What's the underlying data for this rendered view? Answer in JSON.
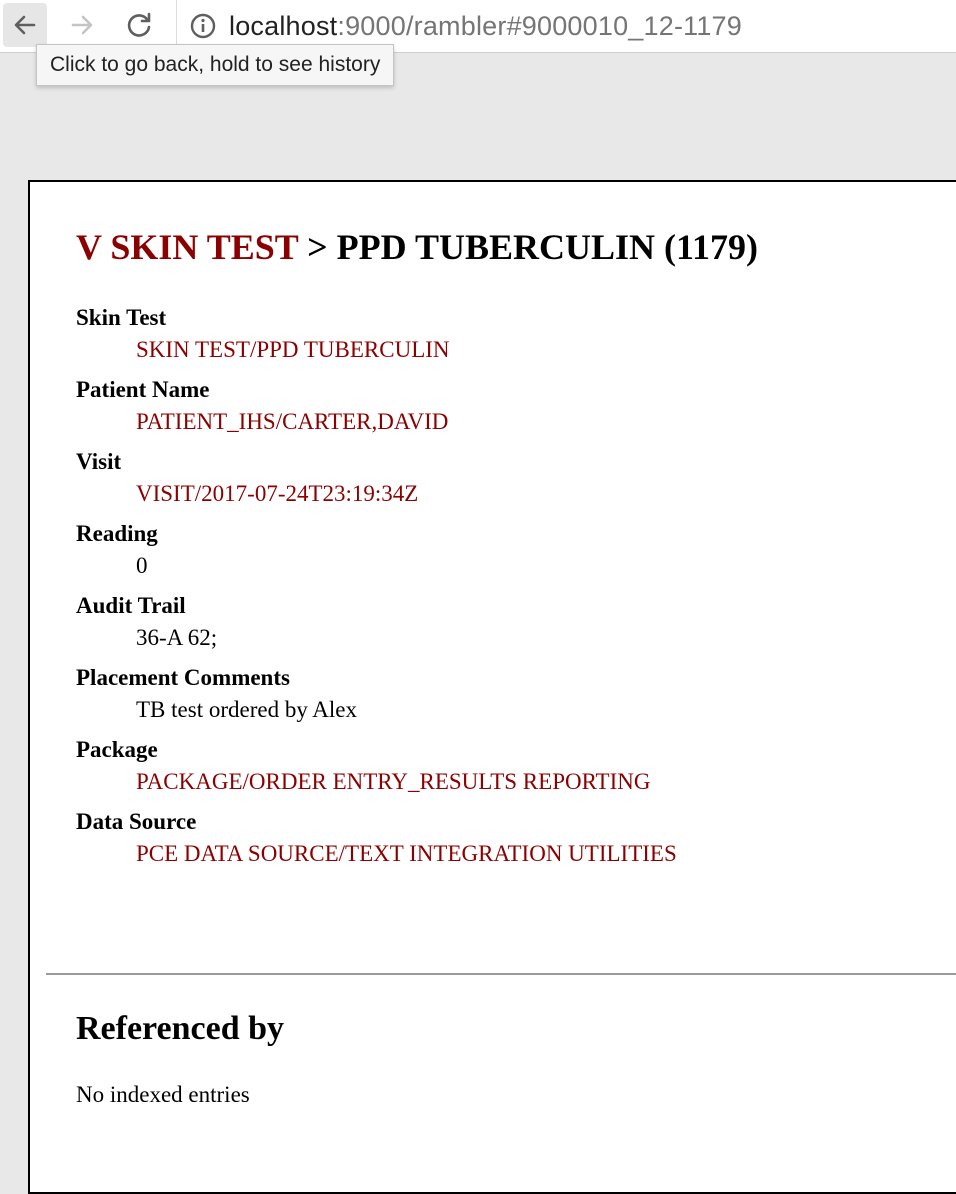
{
  "browser": {
    "url_host": "localhost",
    "url_rest": ":9000/rambler#9000010_12-1179",
    "tooltip": "Click to go back, hold to see history"
  },
  "page": {
    "title_link": "V SKIN TEST",
    "title_rest": " > PPD TUBERCULIN (1179)",
    "fields": [
      {
        "label": "Skin Test",
        "value": "SKIN TEST/PPD TUBERCULIN"
      },
      {
        "label": "Patient Name",
        "value": "PATIENT_IHS/CARTER,DAVID"
      },
      {
        "label": "Visit",
        "value": "VISIT/2017-07-24T23:19:34Z"
      },
      {
        "label": "Reading",
        "value": "0"
      },
      {
        "label": "Audit Trail",
        "value": "36-A 62;"
      },
      {
        "label": "Placement Comments",
        "value": "TB test ordered by Alex"
      },
      {
        "label": "Package",
        "value": "PACKAGE/ORDER ENTRY_RESULTS REPORTING"
      },
      {
        "label": "Data Source",
        "value": "PCE DATA SOURCE/TEXT INTEGRATION UTILITIES"
      }
    ],
    "referenced_by_title": "Referenced by",
    "referenced_by_empty": "No indexed entries"
  }
}
